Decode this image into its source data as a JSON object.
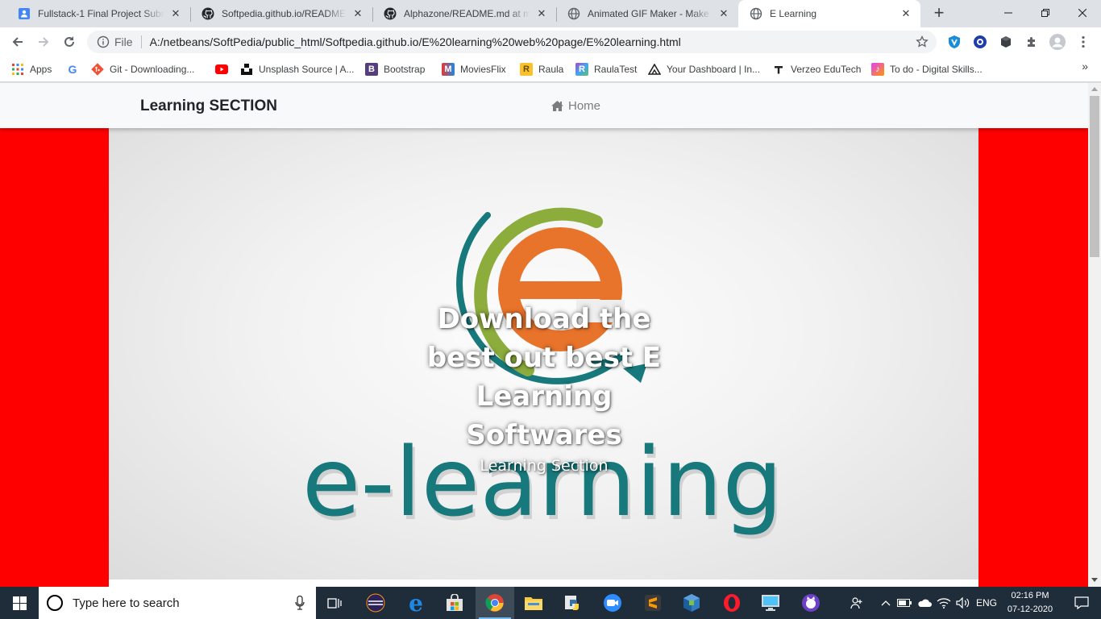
{
  "browser": {
    "tabs": [
      {
        "title": "Fullstack-1 Final Project Submi",
        "favicon": "google-forms-icon",
        "active": false
      },
      {
        "title": "Softpedia.github.io/README.m",
        "favicon": "github-icon",
        "active": false
      },
      {
        "title": "Alphazone/README.md at ma",
        "favicon": "github-icon",
        "active": false
      },
      {
        "title": "Animated GIF Maker - Make G",
        "favicon": "globe-icon",
        "active": false
      },
      {
        "title": "E Learning",
        "favicon": "globe-icon",
        "active": true
      }
    ],
    "address": {
      "scheme_label": "File",
      "url": "A:/netbeans/SoftPedia/public_html/Softpedia.github.io/E%20learning%20web%20page/E%20learning.html"
    },
    "bookmarks": [
      {
        "label": "Apps",
        "icon": "apps-grid-icon"
      },
      {
        "label": "",
        "icon": "google-icon"
      },
      {
        "label": "Git - Downloading...",
        "icon": "git-icon"
      },
      {
        "label": "",
        "icon": "youtube-icon"
      },
      {
        "label": "Unsplash Source | A...",
        "icon": "unsplash-icon"
      },
      {
        "label": "Bootstrap",
        "icon": "bootstrap-icon"
      },
      {
        "label": "MoviesFlix",
        "icon": "moviesflix-icon"
      },
      {
        "label": "Raula",
        "icon": "raula-icon"
      },
      {
        "label": "RaulaTest",
        "icon": "raulatest-icon"
      },
      {
        "label": "Your Dashboard | In...",
        "icon": "dashboard-icon"
      },
      {
        "label": "Verzeo EduTech",
        "icon": "verzeo-icon"
      },
      {
        "label": "To do - Digital Skills...",
        "icon": "todo-icon"
      }
    ]
  },
  "site": {
    "brand": "Learning SECTION",
    "nav_home": "Home",
    "hero": {
      "logo_text": "e-learning",
      "heading": "Download the best out best E Learning Softwares",
      "subheading": "Learning Section"
    },
    "colors": {
      "background": "#ff0000",
      "logo_teal": "#17797b",
      "logo_orange": "#e8732a",
      "logo_green": "#8cac3c"
    }
  },
  "taskbar": {
    "search_placeholder": "Type here to search",
    "language": "ENG",
    "time": "02:16 PM",
    "date": "07-12-2020"
  }
}
